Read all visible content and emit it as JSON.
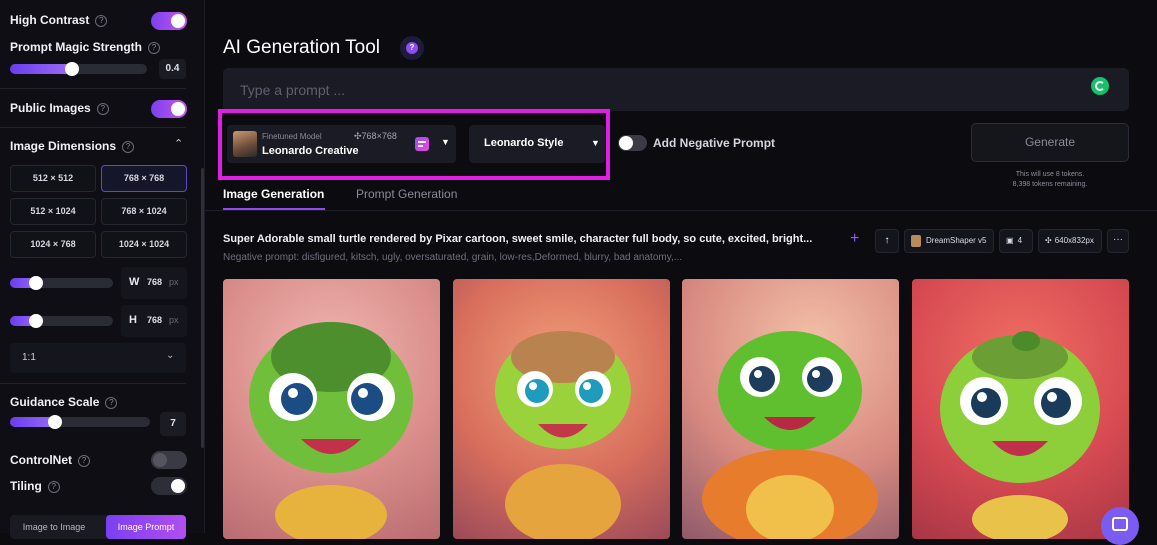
{
  "sidebar": {
    "high_contrast": {
      "label": "High Contrast",
      "on": true
    },
    "prompt_magic": {
      "label": "Prompt Magic Strength",
      "value": "0.4",
      "fraction": 0.4
    },
    "public_images": {
      "label": "Public Images",
      "on": true
    },
    "image_dimensions": {
      "label": "Image Dimensions",
      "options": [
        "512 × 512",
        "768 × 768",
        "512 × 1024",
        "768 × 1024",
        "1024 × 768",
        "1024 × 1024"
      ],
      "selected": "768 × 768"
    },
    "width": {
      "key": "W",
      "value": "768",
      "unit": "px"
    },
    "height": {
      "key": "H",
      "value": "768",
      "unit": "px"
    },
    "aspect_ratio": "1:1",
    "guidance_scale": {
      "label": "Guidance Scale",
      "value": "7"
    },
    "controlnet": {
      "label": "ControlNet",
      "on": false
    },
    "tiling": {
      "label": "Tiling",
      "on": false
    },
    "tabs": [
      "Image to Image",
      "Image Prompt"
    ]
  },
  "header": {
    "title": "AI Generation Tool",
    "help_icon": "question-icon"
  },
  "prompt": {
    "placeholder": "Type a prompt ..."
  },
  "model": {
    "caption": "Finetuned Model",
    "name": "Leonardo Creative",
    "size": "768×768"
  },
  "style": {
    "label": "Leonardo Style"
  },
  "negative": {
    "label": "Add Negative Prompt",
    "on": false
  },
  "generate": {
    "label": "Generate",
    "note1": "This will use 8 tokens.",
    "note2": "8,398 tokens remaining."
  },
  "tabs": {
    "active": "Image Generation",
    "other": "Prompt Generation"
  },
  "generation": {
    "prompt": "Super Adorable small turtle rendered by Pixar cartoon, sweet smile, character full body, so cute, excited, bright...",
    "negative": "Negative prompt: disfigured, kitsch, ugly, oversaturated, grain, low-res,Deformed, blurry, bad anatomy,...",
    "model_chip": "DreamShaper v5",
    "count_chip": "4",
    "size_chip": "640x832px"
  },
  "colors": {
    "accent": "#a64cf0",
    "highlight": "#e11ee6",
    "bg": "#0b0b10"
  }
}
